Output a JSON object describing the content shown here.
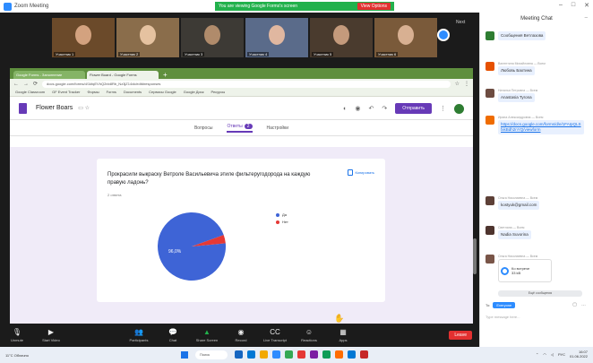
{
  "zoom": {
    "app_title": "Zoom Meeting",
    "share_banner": "You are viewing Google Forms's screen",
    "stop_share": "View Options",
    "participants": [
      {
        "name": "Участник 1",
        "bg": "#6b4a2a",
        "face": "#d3a27f"
      },
      {
        "name": "Участник 2",
        "bg": "#8a6d4b",
        "face": "#e5c2a0"
      },
      {
        "name": "Участник 3",
        "bg": "#3d3a35",
        "face": "#b08b6b"
      },
      {
        "name": "Участник 4",
        "bg": "#5a6b8a",
        "face": "#e0b7a0"
      },
      {
        "name": "Участник 5",
        "bg": "#4a3b2e",
        "face": "#c49a7c"
      },
      {
        "name": "Участник 6",
        "bg": "#7a5a3a",
        "face": "#d8b092"
      }
    ],
    "strip_next": "Next",
    "toolbar": {
      "unmute": "Unmute",
      "start_video": "Start Video",
      "participants": "Participants",
      "chat": "Chat",
      "share_screen": "Share Screen",
      "record": "Record",
      "live_transcript": "Live Transcript",
      "reactions": "Reactions",
      "apps": "Apps",
      "end": "Leave"
    },
    "hand_emoji": "✋"
  },
  "browser": {
    "tabs": [
      {
        "label": "Google Forms - Заполнение"
      },
      {
        "label": "Flower Board - Google Forms"
      }
    ],
    "new_tab": "+",
    "url": "docs.google.com/forms/d/1kfqEVhQ2nb8Rb_Nz3jZ14xk/edit#responses",
    "bookmarks": [
      "Google Classroom",
      "GF Event Tracker",
      "Формы",
      "Forms",
      "Documents",
      "Сервисы Google",
      "Google Диск",
      "Ресурсы"
    ]
  },
  "forms": {
    "title": "Flower Boars",
    "send_label": "Отправить",
    "tabs": [
      {
        "label": "Вопросы"
      },
      {
        "label": "Ответы",
        "badge": "2"
      },
      {
        "label": "Настройки"
      }
    ],
    "question": "Прокрасили выкраску Ветроле Васильевича этиле фильтеругодорода на каждую правую ладонь?",
    "responses_count": "2 ответа",
    "copy_label": "Копировать",
    "pie_label": "96,0%"
  },
  "chart_data": {
    "type": "pie",
    "categories": [
      "Да",
      "Нет"
    ],
    "values": [
      96.0,
      4.0
    ],
    "colors": [
      "#3e64d6",
      "#e53935"
    ],
    "legend_position": "right"
  },
  "chat": {
    "title": "Meeting Chat",
    "messages": [
      {
        "from": "",
        "text": "Сообщения Ветлазова",
        "avatar": "#2e7d32",
        "type": "text"
      },
      {
        "from": "Валентина Михайловна — Всем",
        "text": "Любовь Бахтина",
        "avatar": "#e65100",
        "type": "text"
      },
      {
        "from": "Наталья Петровна — Всем",
        "text": "Anastasia Tyrona",
        "avatar": "#6d4c41",
        "type": "text"
      },
      {
        "from": "Ирина Александровна — Всем",
        "text": "https://docs.google.com/forms/d/e/1FAIpQLSfxkBdh2nYQ/viewform",
        "avatar": "#ef6c00",
        "type": "link"
      },
      {
        "from": "Ольга Николаевна — Всем",
        "text": "kostyuk@gmail.com",
        "avatar": "#5d4037",
        "type": "text"
      },
      {
        "from": "Светлана — Всем",
        "text": "Nadia Suvorina",
        "avatar": "#4e342e",
        "type": "text"
      },
      {
        "from": "Ольга Николаевна — Всем",
        "text": "Ко встрече",
        "file_size": "33 kB",
        "avatar": "#795548",
        "type": "file"
      }
    ],
    "more_label": "Ещё сообщения",
    "to_label": "To:",
    "to_value": "Everyone",
    "input_placeholder": "Type message here..."
  },
  "taskbar": {
    "weather": "11°C Облачно",
    "search": "Поиск",
    "app_colors": [
      "#1565c0",
      "#0078d4",
      "#f2a900",
      "#2d8cff",
      "#34a853",
      "#e53935",
      "#7b1fa2",
      "#0f9d58",
      "#ff6d00",
      "#0078d4",
      "#c62828"
    ],
    "time": "16:07",
    "date": "01.06.2022",
    "lang": "РУС"
  }
}
